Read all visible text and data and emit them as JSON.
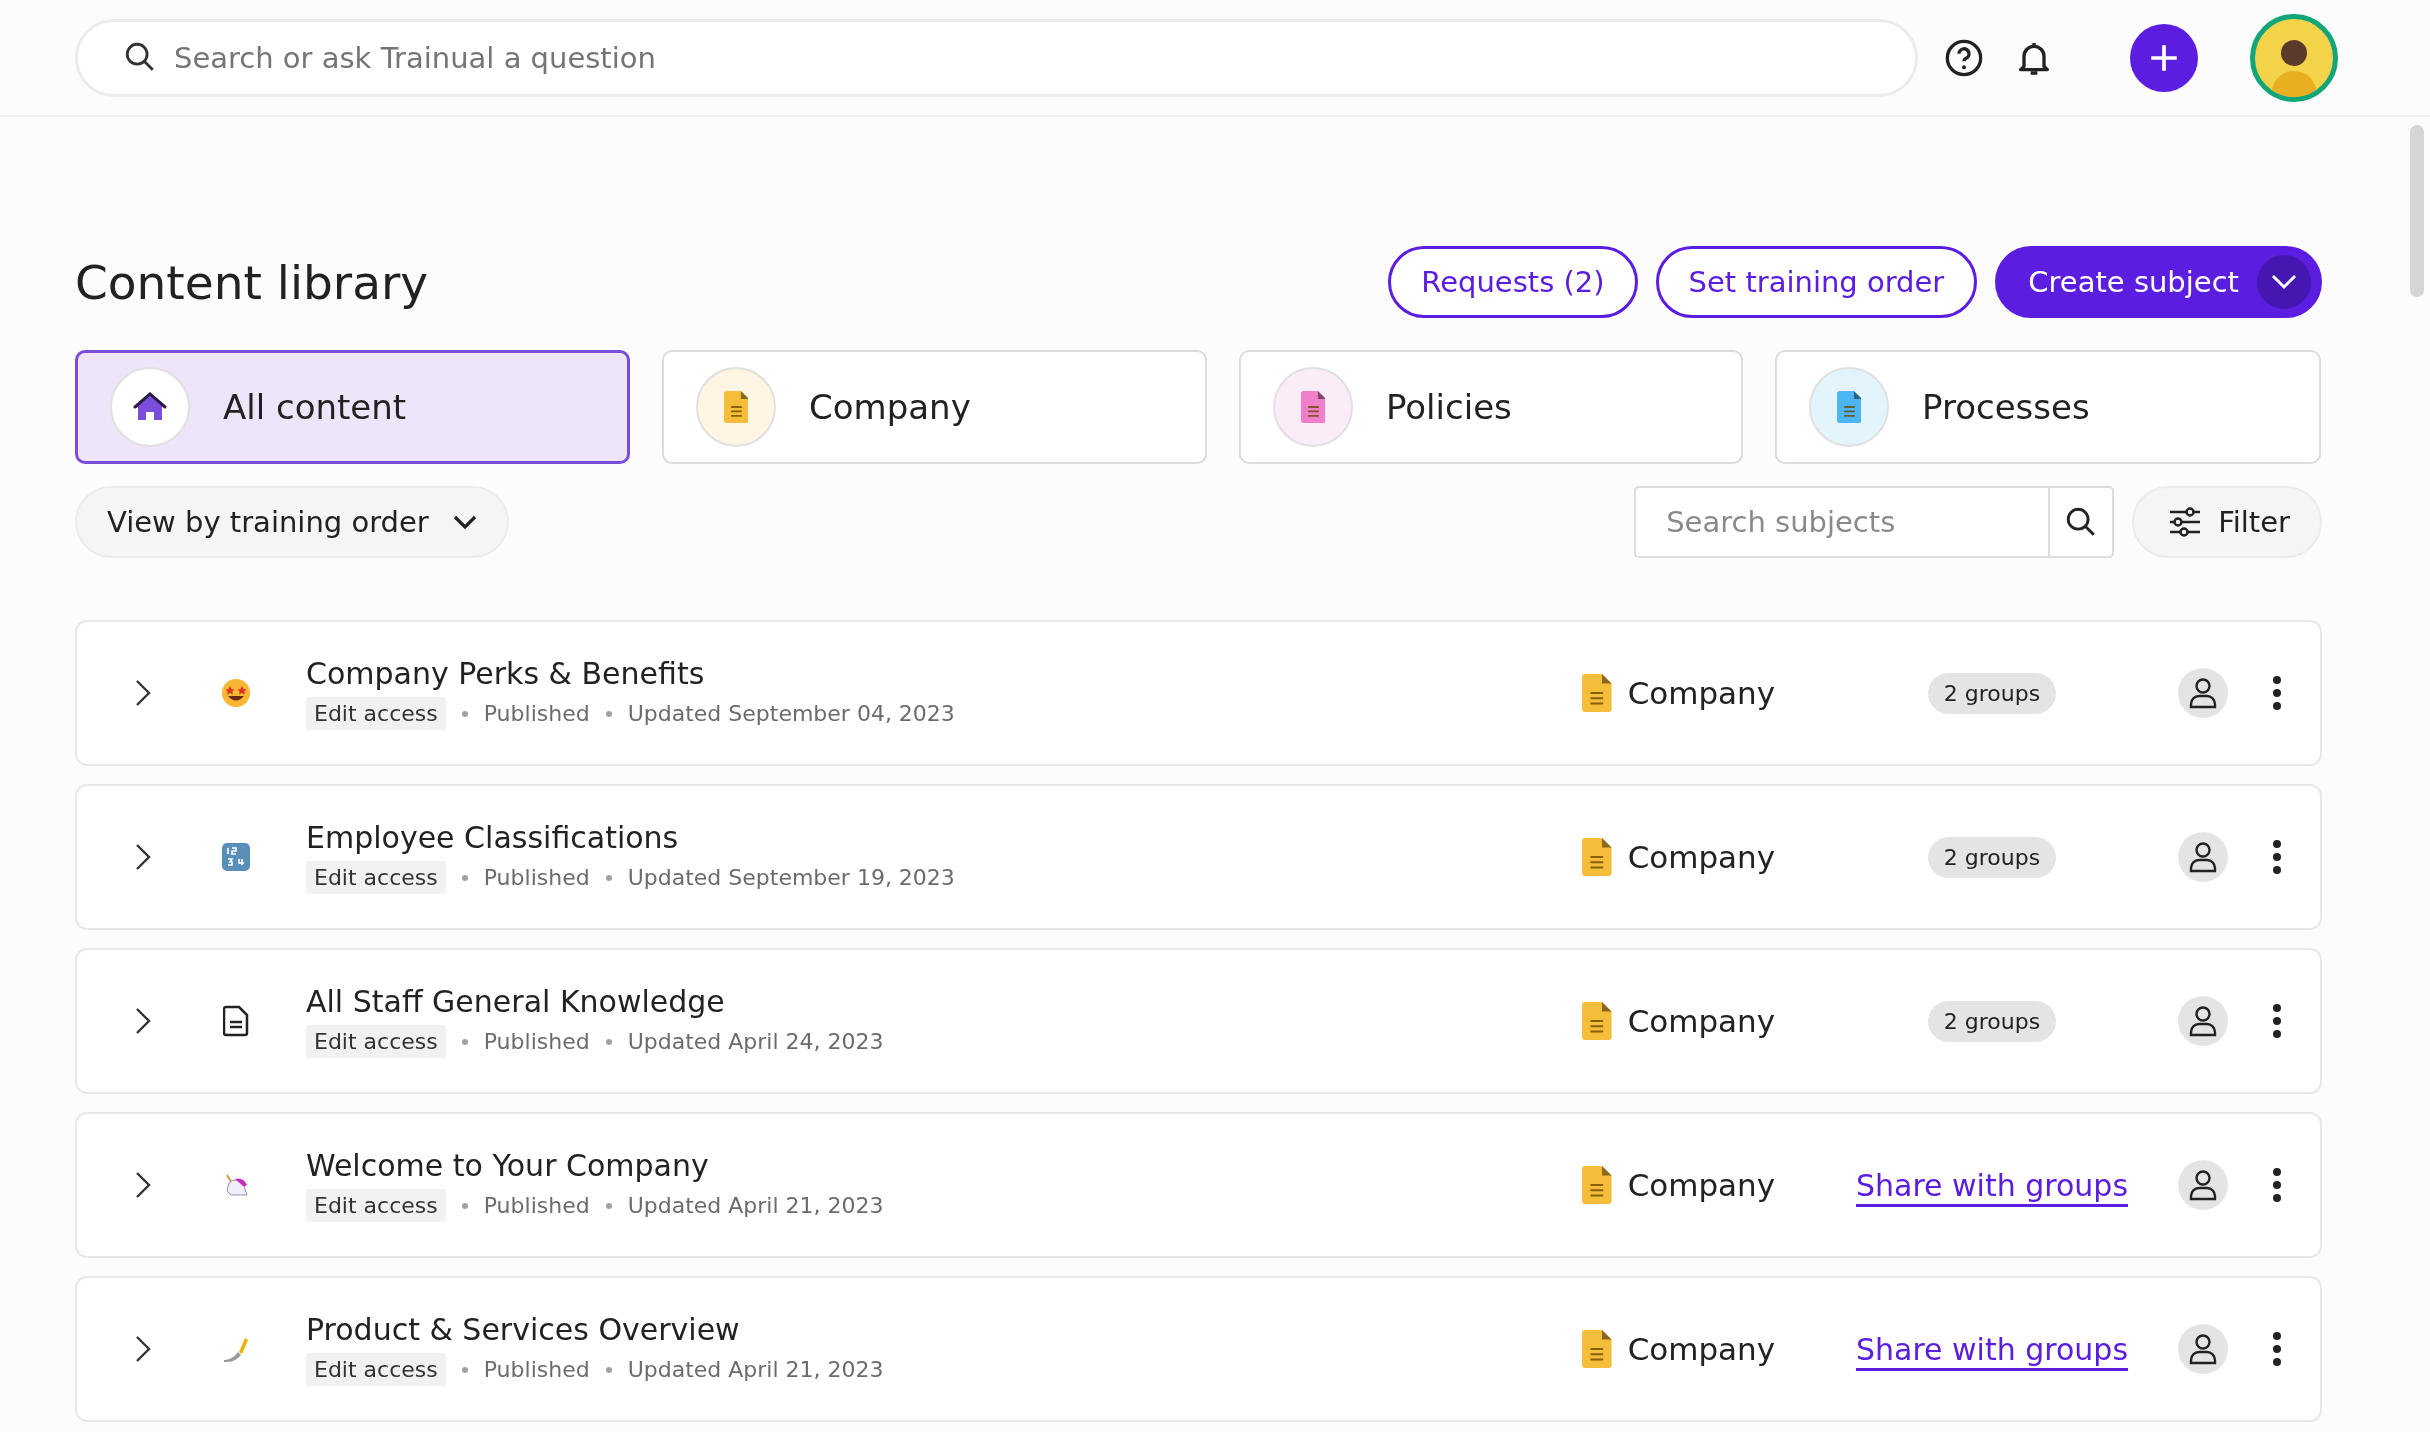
{
  "top_bar": {
    "search": {
      "placeholder": "Search or ask Trainual a question"
    }
  },
  "page": {
    "title": "Content library",
    "actions": [
      {
        "kind": "outline",
        "label": "Requests (2)"
      },
      {
        "kind": "outline",
        "label": "Set training order"
      },
      {
        "kind": "primary",
        "label": "Create subject"
      }
    ],
    "categories": [
      {
        "label": "All content",
        "selected": true,
        "color": "#7c4ddb"
      },
      {
        "label": "Company",
        "selected": false,
        "color": "#f5bd3a"
      },
      {
        "label": "Policies",
        "selected": false,
        "color": "#ee7fc8"
      },
      {
        "label": "Processes",
        "selected": false,
        "color": "#4db5f2"
      }
    ],
    "view_select": {
      "value": "View by training order"
    },
    "subject_search": {
      "placeholder": "Search subjects"
    },
    "filter": {
      "label": "Filter"
    },
    "subjects": [
      {
        "title": "Company Perks & Benefits",
        "access": "Edit access",
        "status": "Published",
        "updated": "Updated September 04, 2023",
        "category": "Company",
        "sharing": {
          "kind": "badge",
          "label": "2 groups"
        }
      },
      {
        "title": "Employee Classifications",
        "access": "Edit access",
        "status": "Published",
        "updated": "Updated September 19, 2023",
        "category": "Company",
        "sharing": {
          "kind": "badge",
          "label": "2 groups"
        }
      },
      {
        "title": "All Staff General Knowledge",
        "access": "Edit access",
        "status": "Published",
        "updated": "Updated April 24, 2023",
        "category": "Company",
        "sharing": {
          "kind": "badge",
          "label": "2 groups"
        }
      },
      {
        "title": "Welcome to Your Company",
        "access": "Edit access",
        "status": "Published",
        "updated": "Updated April 21, 2023",
        "category": "Company",
        "sharing": {
          "kind": "link",
          "label": "Share with groups"
        }
      },
      {
        "title": "Product & Services Overview",
        "access": "Edit access",
        "status": "Published",
        "updated": "Updated April 21, 2023",
        "category": "Company",
        "sharing": {
          "kind": "link",
          "label": "Share with groups"
        }
      }
    ]
  }
}
